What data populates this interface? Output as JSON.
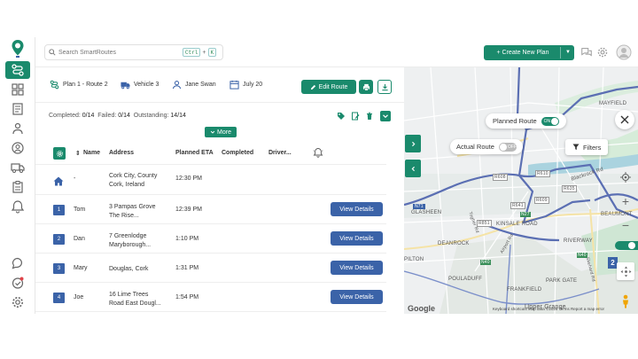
{
  "search": {
    "placeholder": "Search SmartRoutes",
    "kbd_ctrl": "Ctrl",
    "kbd_plus": "+",
    "kbd_k": "K"
  },
  "topbar": {
    "create_plan_label": "+ Create New Plan"
  },
  "route": {
    "plan_label": "Plan 1 - Route 2",
    "vehicle": "Vehicle 3",
    "driver": "Jane Swan",
    "date": "July 20",
    "edit_label": "Edit Route"
  },
  "stats": {
    "completed_label": "Completed:",
    "completed_value": "0/14",
    "failed_label": "Failed:",
    "failed_value": "0/14",
    "outstanding_label": "Outstanding:",
    "outstanding_value": "14/14"
  },
  "more_label": "More",
  "table": {
    "columns": [
      "Name",
      "Address",
      "Planned ETA",
      "Completed",
      "Driver..."
    ],
    "depot": {
      "name": "-",
      "address_line1": "Cork City, County",
      "address_line2": "Cork, Ireland",
      "eta": "12:30 PM"
    },
    "rows": [
      {
        "num": "1",
        "name": "Tom",
        "address_line1": "3 Pampas Grove",
        "address_line2": "The Rise...",
        "eta": "12:39 PM",
        "action": "View Details"
      },
      {
        "num": "2",
        "name": "Dan",
        "address_line1": "7 Greenlodge",
        "address_line2": "Maryborough...",
        "eta": "1:10 PM",
        "action": "View Details"
      },
      {
        "num": "3",
        "name": "Mary",
        "address_line1": "Douglas, Cork",
        "address_line2": "",
        "eta": "1:31 PM",
        "action": "View Details"
      },
      {
        "num": "4",
        "name": "Joe",
        "address_line1": "16 Lime Trees",
        "address_line2": "Road East Dougl...",
        "eta": "1:54 PM",
        "action": "View Details"
      }
    ]
  },
  "map": {
    "planned_route_label": "Planned Route",
    "planned_toggle": "ON",
    "actual_route_label": "Actual Route",
    "actual_toggle": "OFF",
    "filters_label": "Filters",
    "marker_label": "2",
    "labels": {
      "mayfield": "MAYFIELD",
      "blackrock_rd": "Blackrock Rd",
      "beaumont": "BEAUMONT",
      "glasheen": "GLASHEEN",
      "kinsale_road": "KINSALE ROAD",
      "deanrock": "DEANROCK",
      "riverway": "RIVERWAY",
      "pilton": "PILTON",
      "pouladuff": "POULADUFF",
      "park_gate": "PARK GATE",
      "frankfield": "FRANKFIELD",
      "upper_grange": "Upper Grange",
      "togher_rd": "Togher Rd",
      "airport_rd": "Airport Rd",
      "skehard_rd": "Skehard Rd",
      "n40": "N40",
      "n27": "N27",
      "r610": "R610",
      "r608": "R608",
      "r609": "R609",
      "r641": "R641",
      "r851": "R851",
      "r635": "R635",
      "n71": "N71",
      "n40b": "N40"
    },
    "google": "Google",
    "footer": "Keyboard shortcuts   Map data ©2026   Terms   Report a map error"
  },
  "colors": {
    "brand": "#1a8a6c",
    "row_button": "#3b63a8",
    "route_line": "#5b6fb3"
  }
}
